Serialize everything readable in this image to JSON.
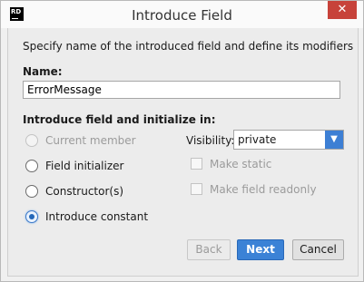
{
  "window": {
    "icon_text": "RD",
    "title": "Introduce Field",
    "close_glyph": "✕"
  },
  "description": "Specify name of the introduced field and define its modifiers",
  "name_field": {
    "label": "Name:",
    "value": "ErrorMessage"
  },
  "init_section": {
    "label": "Introduce field and initialize in:",
    "options": [
      {
        "label": "Current member",
        "state": "disabled"
      },
      {
        "label": "Field initializer",
        "state": "unchecked"
      },
      {
        "label": "Constructor(s)",
        "state": "unchecked"
      },
      {
        "label": "Introduce constant",
        "state": "checked"
      }
    ]
  },
  "visibility": {
    "label": "Visibility:",
    "selected": "private",
    "arrow_glyph": "▼"
  },
  "modifiers": [
    {
      "label": "Make static",
      "checked": false,
      "enabled": false
    },
    {
      "label": "Make field readonly",
      "checked": false,
      "enabled": false
    }
  ],
  "buttons": {
    "back": "Back",
    "next": "Next",
    "cancel": "Cancel"
  },
  "colors": {
    "accent": "#3b82d6",
    "close_button": "#c7423a"
  }
}
